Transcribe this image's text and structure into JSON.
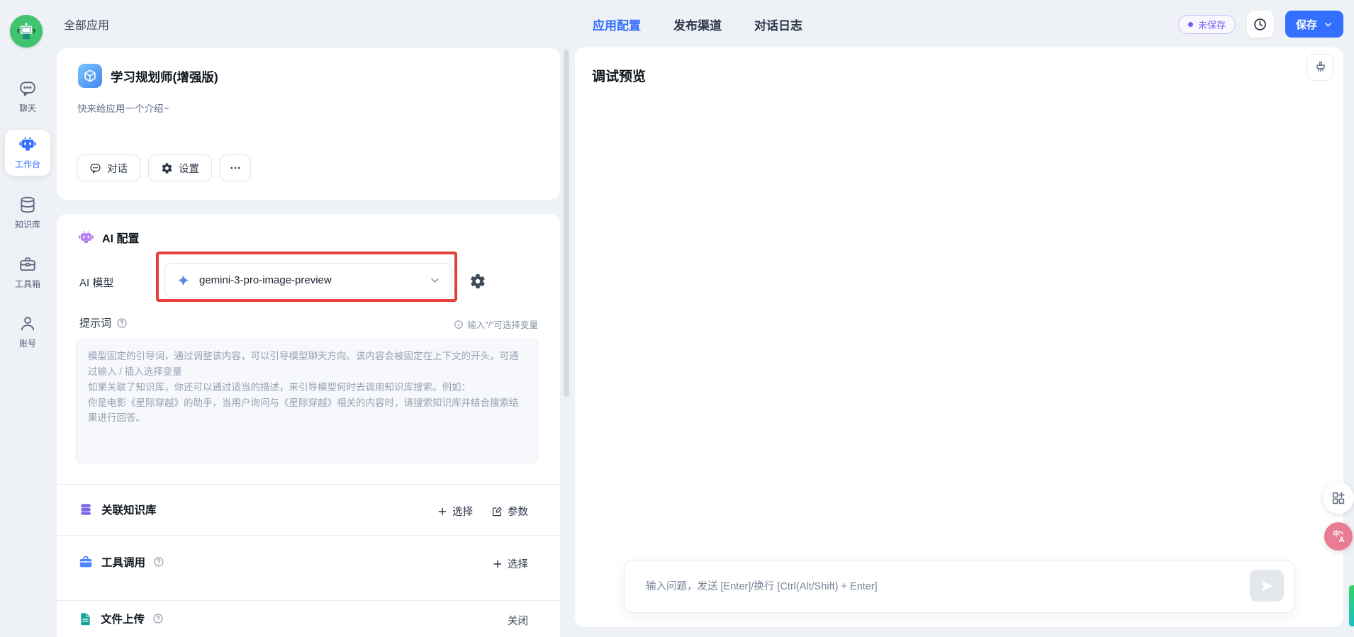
{
  "topbar": {
    "back_label": "全部应用",
    "tabs": [
      {
        "label": "应用配置",
        "active": true
      },
      {
        "label": "发布渠道",
        "active": false
      },
      {
        "label": "对话日志",
        "active": false
      }
    ],
    "unsaved_badge": "未保存",
    "save_label": "保存"
  },
  "sidebar": {
    "items": [
      {
        "label": "聊天",
        "icon": "chat-bubble-icon"
      },
      {
        "label": "工作台",
        "icon": "robot-icon",
        "active": true
      },
      {
        "label": "知识库",
        "icon": "database-icon"
      },
      {
        "label": "工具箱",
        "icon": "toolbox-icon"
      },
      {
        "label": "账号",
        "icon": "user-icon"
      }
    ]
  },
  "app_card": {
    "title": "学习规划师(增强版)",
    "description": "快来给应用一个介绍~",
    "chat_button": "对话",
    "settings_button": "设置"
  },
  "ai_config": {
    "section_title": "AI 配置",
    "model_label": "AI 模型",
    "model_value": "gemini-3-pro-image-preview",
    "prompt_label": "提示词",
    "prompt_hint": "输入\"/\"可选择变量",
    "prompt_placeholder": "模型固定的引导词，通过调整该内容，可以引导模型聊天方向。该内容会被固定在上下文的开头。可通过输入 / 插入选择变量\n如果关联了知识库，你还可以通过适当的描述，来引导模型何时去调用知识库搜索。例如：\n你是电影《星际穿越》的助手，当用户询问与《星际穿越》相关的内容时，请搜索知识库并结合搜索结果进行回答。"
  },
  "dataset_section": {
    "title": "关联知识库",
    "select_action": "选择",
    "params_action": "参数"
  },
  "tool_section": {
    "title": "工具调用",
    "select_action": "选择"
  },
  "file_section": {
    "title": "文件上传",
    "status": "关闭"
  },
  "debug_panel": {
    "title": "调试预览",
    "input_placeholder": "输入问题，发送 [Enter]/换行 [Ctrl(Alt/Shift) + Enter]"
  },
  "floating": {
    "translate_zh": "中",
    "translate_a": "A"
  },
  "colors": {
    "primary_blue": "#3370ff",
    "highlight_red": "#e5413c",
    "unsaved_purple": "#7a5cf0",
    "ai_robot_purple": "#b37ef0",
    "dataset_purple": "#7b6ce6",
    "tool_blue": "#4e83fd",
    "file_teal": "#12a29b",
    "logo_green": "#41c46f"
  }
}
